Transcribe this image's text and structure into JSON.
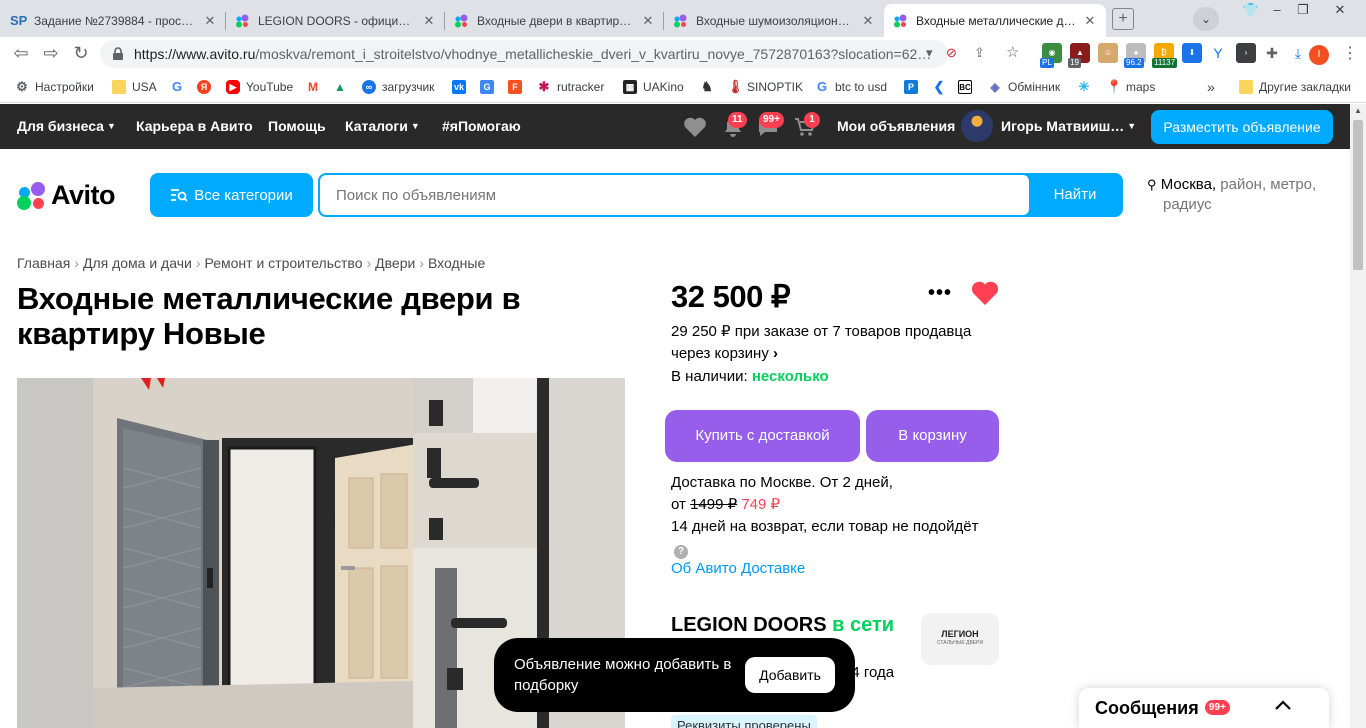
{
  "browser": {
    "tabs": [
      {
        "title": "Задание №2739884 - просмотр",
        "favicon": "sp"
      },
      {
        "title": "LEGION DOORS - официальный сайт",
        "favicon": "avito"
      },
      {
        "title": "Входные двери в квартиру с шумоизоляцией",
        "favicon": "avito"
      },
      {
        "title": "Входные шумоизоляционные двери",
        "favicon": "avito"
      },
      {
        "title": "Входные металлические двери",
        "favicon": "avito"
      }
    ],
    "url_host": "https://www.avito.ru",
    "url_path": "/moskva/remont_i_stroitelstvo/vhodnye_metallicheskie_dveri_v_kvartiru_novye_7572870163?slocation=62…",
    "extension_badges": {
      "pl": "PL",
      "count19": "19",
      "weather": "96.2",
      "btc": "11137"
    },
    "profile_initial": "I",
    "bookmarks": [
      {
        "label": "Настройки",
        "icon": "gear-icon"
      },
      {
        "label": "USA",
        "icon": "folder-icon"
      },
      {
        "label": "",
        "icon": "google-icon"
      },
      {
        "label": "",
        "icon": "yandex-icon"
      },
      {
        "label": "YouTube",
        "icon": "youtube-icon"
      },
      {
        "label": "",
        "icon": "gmail-icon"
      },
      {
        "label": "",
        "icon": "drive-icon"
      },
      {
        "label": "загрузчик",
        "icon": "loader-icon"
      },
      {
        "label": "",
        "icon": "vk-icon"
      },
      {
        "label": "",
        "icon": "translate-icon"
      },
      {
        "label": "",
        "icon": "f-icon"
      },
      {
        "label": "rutracker",
        "icon": "rutracker-icon"
      },
      {
        "label": "UAKino",
        "icon": "uakino-icon"
      },
      {
        "label": "",
        "icon": "chess-icon"
      },
      {
        "label": "SINOPTIK",
        "icon": "thermometer-icon"
      },
      {
        "label": "btc to usd",
        "icon": "google-icon"
      },
      {
        "label": "",
        "icon": "p-icon"
      },
      {
        "label": "",
        "icon": "arrow-icon"
      },
      {
        "label": "",
        "icon": "bc-icon"
      },
      {
        "label": "Обмінник",
        "icon": "exchange-icon"
      },
      {
        "label": "",
        "icon": "star-icon"
      },
      {
        "label": "maps",
        "icon": "maps-icon"
      }
    ],
    "bookmarks_more": "»",
    "other_bookmarks": "Другие закладки"
  },
  "topnav": {
    "business": "Для бизнеса",
    "career": "Карьера в Авито",
    "help": "Помощь",
    "catalogs": "Каталоги",
    "ihelp": "#яПомогаю",
    "notifications_count": "11",
    "messages_count": "99+",
    "cart_count": "1",
    "my_ads": "Мои объявления",
    "user_name": "Игорь Матвииш…",
    "post_ad": "Разместить объявление"
  },
  "header": {
    "logo": "Avito",
    "all_categories": "Все категории",
    "search_placeholder": "Поиск по объявлениям",
    "search_button": "Найти",
    "location_city": "Москва,",
    "location_rest": " район, метро,",
    "location_line2": "радиус"
  },
  "breadcrumbs": [
    "Главная",
    "Для дома и дачи",
    "Ремонт и строительство",
    "Двери",
    "Входные"
  ],
  "listing": {
    "title": "Входные металлические двери в квартиру Новые",
    "price": "32 500 ₽",
    "bulk_price": "29 250 ₽ при заказе от 7 товаров продавца через корзину",
    "stock_label": "В наличии:",
    "stock_value": "несколько",
    "buy_button": "Купить с доставкой",
    "cart_button": "В корзину",
    "delivery_line": "Доставка по Москве. От 2 дней,",
    "delivery_from": "от",
    "delivery_old_price": "1499 ₽",
    "delivery_new_price": "749 ₽",
    "return_policy": "14 дней на возврат, если товар не подойдёт",
    "about_delivery": "Об Авито Доставке",
    "seller_name": "LEGION DOORS",
    "seller_status": "в сети",
    "seller_logo_text": "ЛЕГИОН",
    "seller_logo_sub": "СТАЛЬНЫЕ ДВЕРИ",
    "seller_since": "24 года",
    "verified": "Реквизиты проверены"
  },
  "toast": {
    "message": "Объявление можно добавить в подборку",
    "button": "Добавить"
  },
  "messenger": {
    "label": "Сообщения",
    "count": "99+"
  },
  "colors": {
    "avito_blue": "#00aaff",
    "purple": "#965eeb",
    "green": "#02d15c",
    "red": "#ff4053",
    "dark_nav": "#292929"
  }
}
